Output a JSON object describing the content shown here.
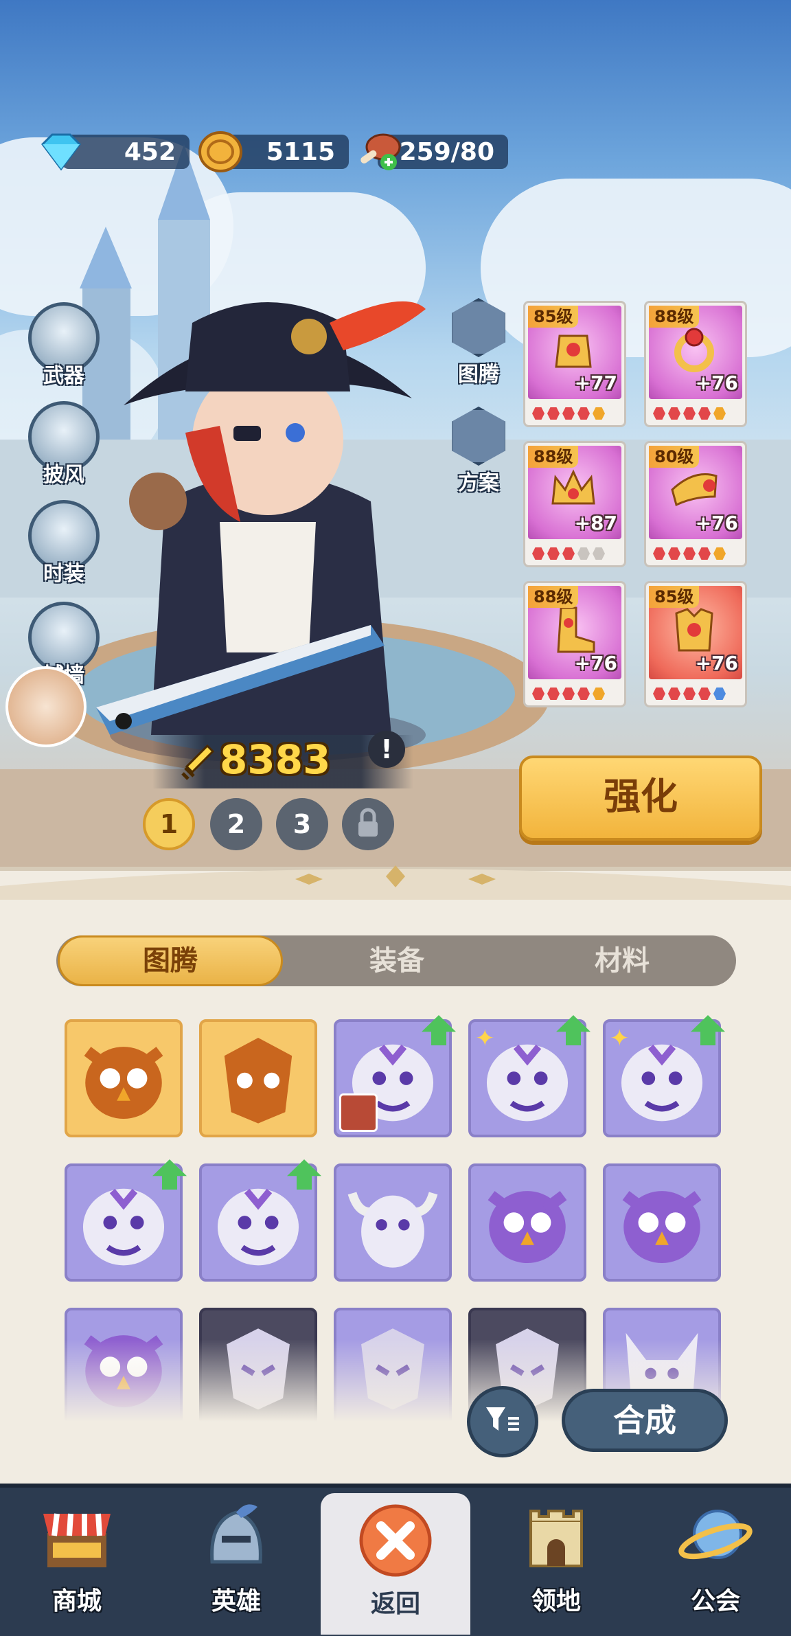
{
  "currency": {
    "diamonds": "452",
    "gold": "5115",
    "stamina": "259/80"
  },
  "side_menu": [
    {
      "label": "武器",
      "icon": "wings-sword-icon"
    },
    {
      "label": "披风",
      "icon": "cape-icon"
    },
    {
      "label": "时装",
      "icon": "costume-icon"
    },
    {
      "label": "城墙",
      "icon": "castle-wall-icon"
    }
  ],
  "hex_menu": [
    {
      "label": "图腾",
      "icon": "totem-icon"
    },
    {
      "label": "方案",
      "icon": "loadout-swap-icon"
    }
  ],
  "equipment": [
    {
      "level": "85级",
      "bonus": "+77",
      "icon": "gloves-icon",
      "gems": [
        "r",
        "r",
        "r",
        "r",
        "y"
      ],
      "color": "purple"
    },
    {
      "level": "88级",
      "bonus": "+76",
      "icon": "ring-icon",
      "gems": [
        "r",
        "r",
        "r",
        "r",
        "y"
      ],
      "color": "purple"
    },
    {
      "level": "88级",
      "bonus": "+87",
      "icon": "crown-icon",
      "gems": [
        "r",
        "r",
        "r",
        "g",
        "g"
      ],
      "color": "purple"
    },
    {
      "level": "80级",
      "bonus": "+76",
      "icon": "horn-icon",
      "gems": [
        "r",
        "r",
        "r",
        "r",
        "y"
      ],
      "color": "purple"
    },
    {
      "level": "88级",
      "bonus": "+76",
      "icon": "boots-icon",
      "gems": [
        "r",
        "r",
        "r",
        "r",
        "y"
      ],
      "color": "purple"
    },
    {
      "level": "85级",
      "bonus": "+76",
      "icon": "armor-icon",
      "gems": [
        "r",
        "r",
        "r",
        "r",
        "b"
      ],
      "color": "red"
    }
  ],
  "power": "8383",
  "loadout_slots": [
    "1",
    "2",
    "3"
  ],
  "enhance_label": "强化",
  "tabs": [
    "图腾",
    "装备",
    "材料"
  ],
  "totems": [
    {
      "icon": "owl-totem-icon",
      "style": "gold"
    },
    {
      "icon": "lion-totem-icon",
      "style": "gold"
    },
    {
      "icon": "tiger-totem-icon",
      "style": "purple",
      "up": true,
      "avatar": true
    },
    {
      "icon": "tiger-totem-icon",
      "style": "purple",
      "up": true,
      "star": true
    },
    {
      "icon": "tiger-totem-icon",
      "style": "purple",
      "up": true,
      "star": true
    },
    {
      "icon": "tiger-totem-icon",
      "style": "purple",
      "up": true
    },
    {
      "icon": "tiger-totem-icon",
      "style": "purple",
      "up": true
    },
    {
      "icon": "ox-totem-icon",
      "style": "purple"
    },
    {
      "icon": "owl-totem-icon",
      "style": "purple"
    },
    {
      "icon": "owl-totem-icon",
      "style": "purple"
    },
    {
      "icon": "owl-totem-icon",
      "style": "purple"
    },
    {
      "icon": "dragon-totem-icon",
      "style": "dark"
    },
    {
      "icon": "dragon-totem-icon",
      "style": "purple"
    },
    {
      "icon": "dragon-totem-icon",
      "style": "dark"
    },
    {
      "icon": "fox-totem-icon",
      "style": "purple"
    }
  ],
  "combine_label": "合成",
  "nav": [
    {
      "label": "商城",
      "icon": "shop-icon"
    },
    {
      "label": "英雄",
      "icon": "helmet-icon"
    },
    {
      "label": "返回",
      "icon": "close-icon",
      "active": true
    },
    {
      "label": "领地",
      "icon": "castle-icon"
    },
    {
      "label": "公会",
      "icon": "planet-icon"
    }
  ],
  "colors": {
    "accent_gold": "#f2b43c",
    "nav_bg": "#2c3b50",
    "panel_bg": "#f1ece2"
  }
}
